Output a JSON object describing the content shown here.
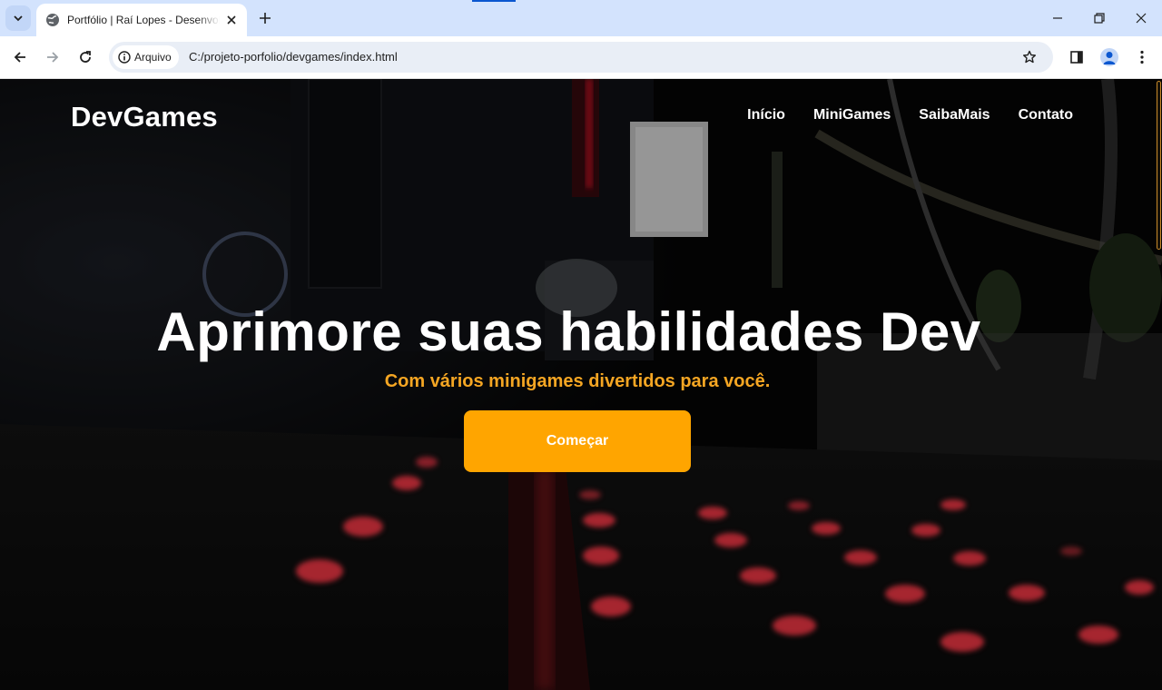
{
  "browser": {
    "tab_title": "Portfólio | Raí Lopes - Desenvolvedor",
    "site_info_label": "Arquivo",
    "url": "C:/projeto-porfolio/devgames/index.html",
    "icons": [
      "tab-search-icon",
      "globe-icon",
      "close-icon",
      "plus-icon",
      "minimize-icon",
      "restore-icon",
      "window-close-icon",
      "back-icon",
      "forward-icon",
      "reload-icon",
      "info-icon",
      "star-icon",
      "side-panel-icon",
      "profile-icon",
      "kebab-menu-icon"
    ],
    "accent_color": "#0b57d0"
  },
  "site": {
    "brand": "DevGames",
    "nav": [
      {
        "label": "Início"
      },
      {
        "label": "MiniGames"
      },
      {
        "label": "SaibaMais"
      },
      {
        "label": "Contato"
      }
    ],
    "hero": {
      "title": "Aprimore suas habilidades Dev",
      "subtitle": "Com vários minigames divertidos para você.",
      "cta_label": "Começar"
    },
    "colors": {
      "accent": "#ffa500",
      "subtitle": "#f5a623",
      "text": "#ffffff"
    }
  }
}
